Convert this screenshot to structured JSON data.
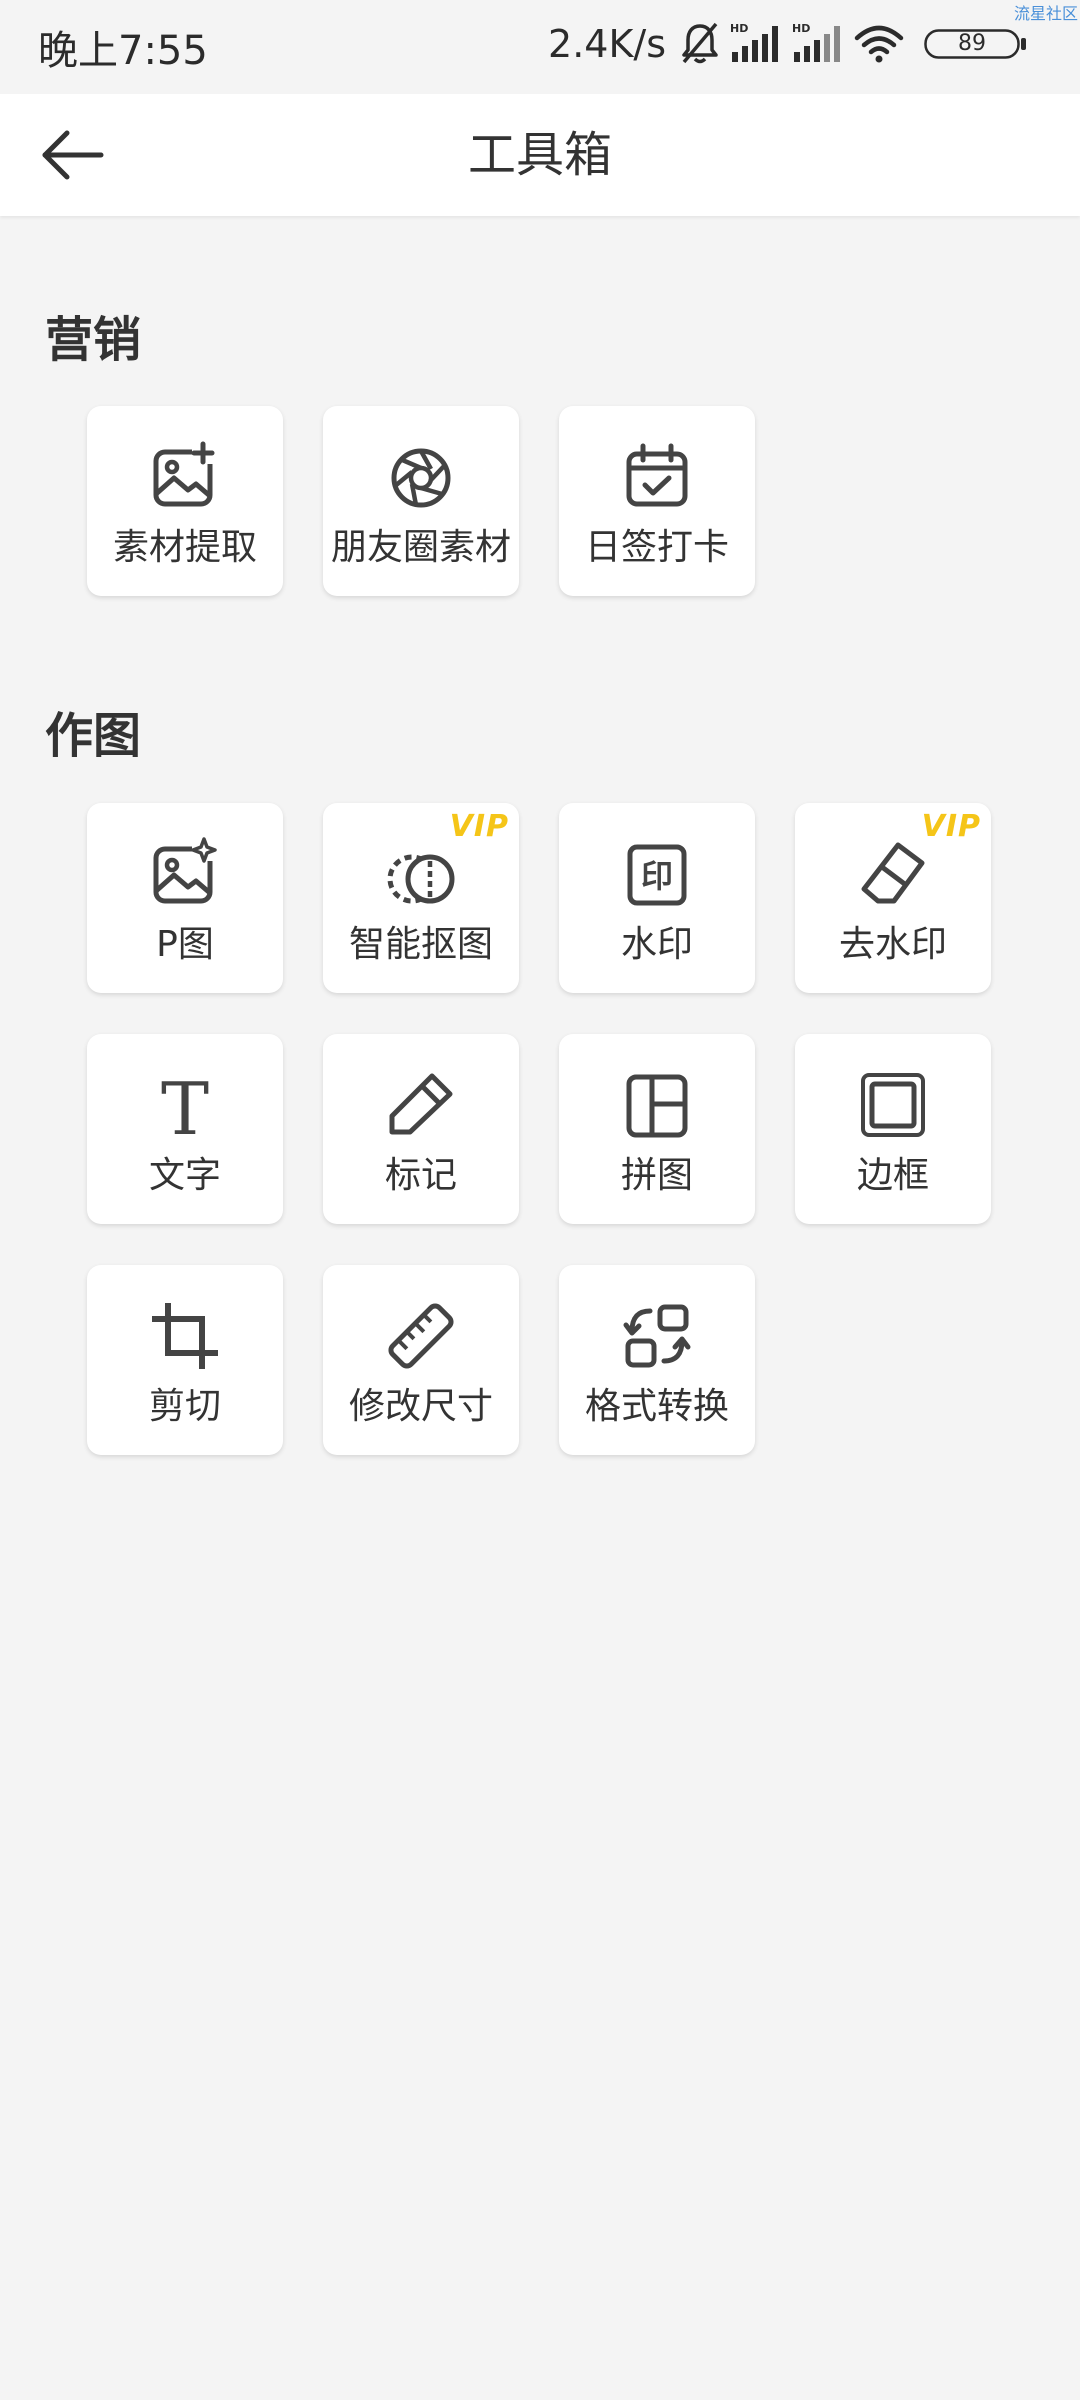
{
  "status_bar": {
    "time": "晚上7:55",
    "net_speed": "2.4K/s",
    "battery": "89",
    "watermark": "流星社区"
  },
  "header": {
    "title": "工具箱"
  },
  "sections": [
    {
      "title": "营销",
      "tools": [
        {
          "label": "素材提取",
          "icon": "image-plus-icon",
          "vip": false
        },
        {
          "label": "朋友圈素材",
          "icon": "aperture-icon",
          "vip": false
        },
        {
          "label": "日签打卡",
          "icon": "calendar-check-icon",
          "vip": false
        }
      ]
    },
    {
      "title": "作图",
      "tools": [
        {
          "label": "P图",
          "icon": "image-sparkle-icon",
          "vip": false
        },
        {
          "label": "智能抠图",
          "icon": "cutout-circles-icon",
          "vip": true,
          "badge": "VIP"
        },
        {
          "label": "水印",
          "icon": "stamp-icon",
          "vip": false
        },
        {
          "label": "去水印",
          "icon": "eraser-icon",
          "vip": true,
          "badge": "VIP"
        },
        {
          "label": "文字",
          "icon": "text-icon",
          "vip": false
        },
        {
          "label": "标记",
          "icon": "pencil-icon",
          "vip": false
        },
        {
          "label": "拼图",
          "icon": "collage-layout-icon",
          "vip": false
        },
        {
          "label": "边框",
          "icon": "frame-icon",
          "vip": false
        },
        {
          "label": "剪切",
          "icon": "crop-icon",
          "vip": false
        },
        {
          "label": "修改尺寸",
          "icon": "ruler-icon",
          "vip": false
        },
        {
          "label": "格式转换",
          "icon": "convert-icon",
          "vip": false
        }
      ]
    }
  ],
  "colors": {
    "background": "#f4f4f4",
    "card": "#ffffff",
    "text": "#333333",
    "vip": "#f5c518",
    "icon": "#444444"
  }
}
